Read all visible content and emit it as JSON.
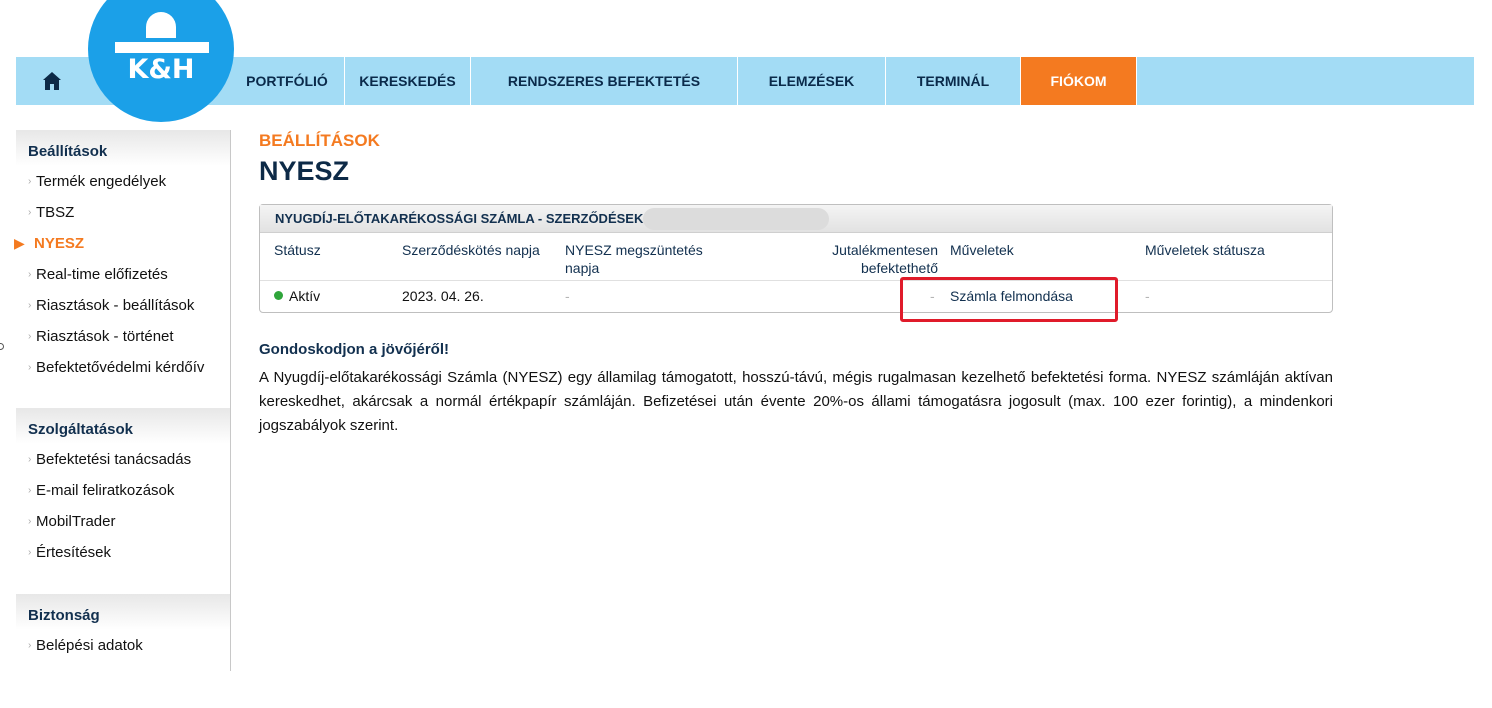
{
  "nav": {
    "home_icon": "home-icon",
    "logo_text": "K&H",
    "items": [
      {
        "label": "PORTFÓLIÓ",
        "active": false
      },
      {
        "label": "KERESKEDÉS",
        "active": false
      },
      {
        "label": "RENDSZERES BEFEKTETÉS",
        "active": false
      },
      {
        "label": "ELEMZÉSEK",
        "active": false
      },
      {
        "label": "TERMINÁL",
        "active": false
      },
      {
        "label": "FIÓKOM",
        "active": true
      }
    ],
    "active_color": "#f47a20",
    "bar_color": "#a3dcf5",
    "logo_color": "#1ba0e8"
  },
  "sidebar": {
    "groups": [
      {
        "title": "Beállítások",
        "items": [
          "Termék engedélyek",
          "TBSZ",
          "NYESZ",
          "Real-time előfizetés",
          "Riasztások - beállítások",
          "Riasztások - történet",
          "Befektetővédelmi kérdőív"
        ]
      },
      {
        "title": "Szolgáltatások",
        "items": [
          "Befektetési tanácsadás",
          "E-mail feliratkozások",
          "MobilTrader",
          "Értesítések"
        ]
      },
      {
        "title": "Biztonság",
        "items": [
          "Belépési adatok"
        ]
      }
    ],
    "active_item": "NYESZ"
  },
  "main": {
    "kicker": "BEÁLLÍTÁSOK",
    "title": "NYESZ",
    "panel": {
      "title": "NYUGDÍJ-ELŐTAKARÉKOSSÁGI SZÁMLA - SZERZŐDÉSEK",
      "columns": [
        "Státusz",
        "Szerződéskötés napja",
        "NYESZ megszüntetés napja",
        "Jutalékmentesen befektethető",
        "Műveletek",
        "Műveletek státusza"
      ],
      "rows": [
        {
          "status": "Aktív",
          "contract_date": "2023. 04. 26.",
          "termination_date": "-",
          "commission_free": "-",
          "action": "Számla felmondása",
          "action_status": "-"
        }
      ]
    },
    "promo": {
      "title": "Gondoskodjon a jövőjéről!",
      "text": "A Nyugdíj-előtakarékossági Számla (NYESZ) egy államilag támogatott, hosszú-távú, mégis rugalmasan kezelhető befektetési forma. NYESZ számláján aktívan kereskedhet, akárcsak a normál értékpapír számláján. Befizetései után évente 20%-os állami támogatásra jogosult (max. 100 ezer forintig), a mindenkori jogszabályok szerint."
    }
  }
}
